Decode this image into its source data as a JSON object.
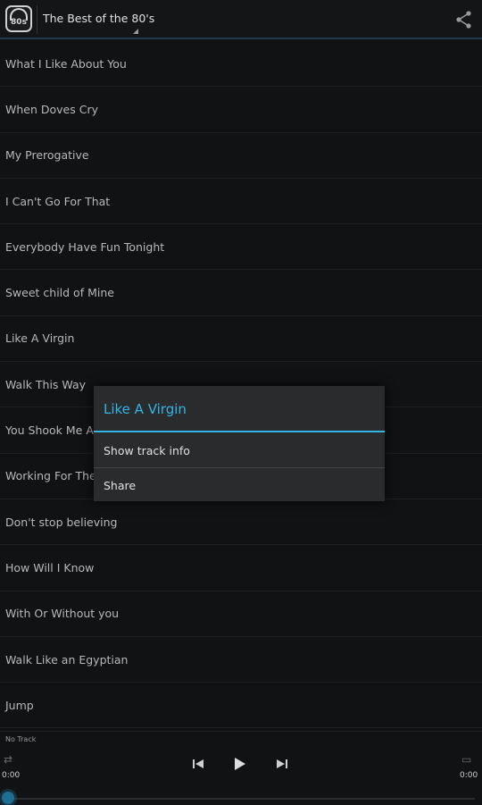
{
  "actionbar": {
    "app_icon_text": "80s",
    "playlist_title": "The Best of the 80's"
  },
  "tracks": [
    "What I Like About You",
    "When Doves Cry",
    "My Prerogative",
    "I Can't Go For That",
    "Everybody Have Fun Tonight",
    "Sweet child of Mine",
    "Like A Virgin",
    "Walk This Way",
    "You Shook Me All Night Long",
    "Working For The Weekend",
    "Don't stop believing",
    "How Will I Know",
    "With Or Without you",
    "Walk Like an Egyptian",
    "Jump"
  ],
  "player": {
    "now_playing": "No Track",
    "elapsed": "0:00",
    "duration": "0:00",
    "progress": 0
  },
  "dialog": {
    "title": "Like A Virgin",
    "items": [
      "Show track info",
      "Share"
    ]
  },
  "colors": {
    "accent": "#33b5e5",
    "background": "#111213"
  },
  "icons": {
    "share": "share-icon",
    "shuffle": "shuffle-icon",
    "repeat": "repeat-icon",
    "prev": "skip-previous-icon",
    "play": "play-icon",
    "next": "skip-next-icon"
  }
}
